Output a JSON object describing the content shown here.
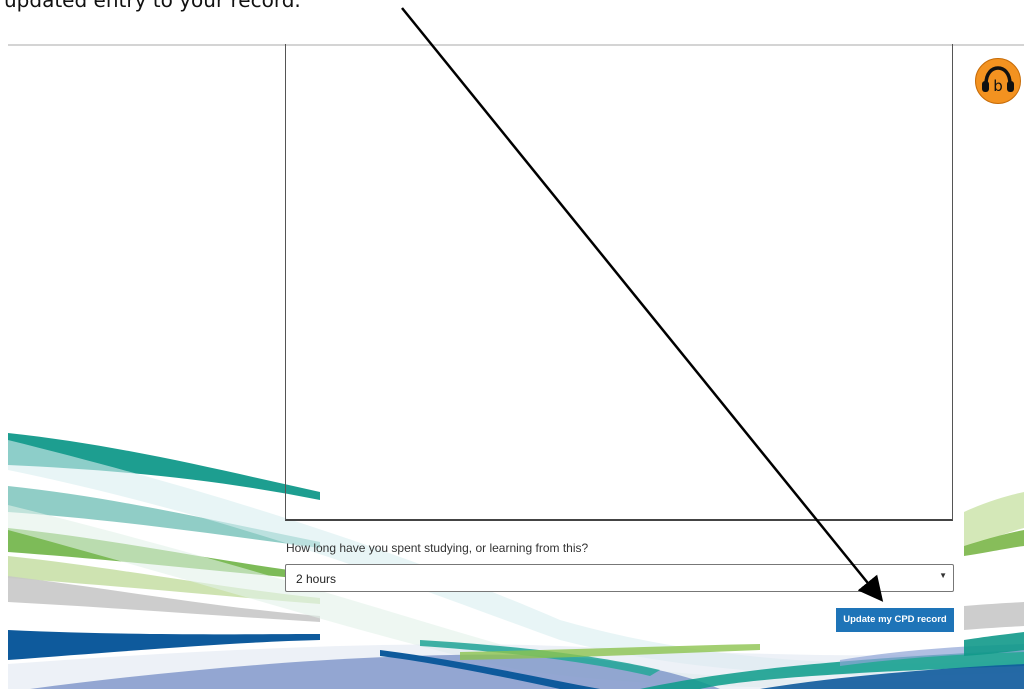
{
  "instruction": {
    "text": "updated entry to your record."
  },
  "form": {
    "question_label": "How long have you spent studying, or learning from this?",
    "duration_value": "2 hours",
    "update_button_label": "Update my CPD record"
  },
  "icons": {
    "accessibility_toolbar": "headphones-b-icon",
    "select_caret": "caret-down-icon"
  },
  "colors": {
    "button_blue": "#1e74b8",
    "assist_orange": "#f39220",
    "wave_teal": "#0b9b8a",
    "wave_green": "#7ab648",
    "wave_navy": "#0e5a9c"
  }
}
